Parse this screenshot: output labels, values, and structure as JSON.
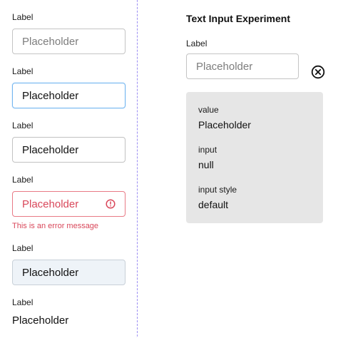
{
  "fields": [
    {
      "label": "Label",
      "value": "Placeholder"
    },
    {
      "label": "Label",
      "value": "Placeholder"
    },
    {
      "label": "Label",
      "value": "Placeholder"
    },
    {
      "label": "Label",
      "value": "Placeholder",
      "error_message": "This is an error message"
    },
    {
      "label": "Label",
      "value": "Placeholder"
    },
    {
      "label": "Label",
      "value": "Placeholder"
    }
  ],
  "experiment": {
    "title": "Text Input Experiment",
    "label": "Label",
    "placeholder": "Placeholder",
    "state": {
      "value_key": "value",
      "value_val": "Placeholder",
      "input_key": "input",
      "input_val": "null",
      "style_key": "input style",
      "style_val": "default"
    }
  },
  "icons": {
    "error": "error-circle-icon",
    "clear": "close-circle-icon"
  },
  "colors": {
    "focus_border": "#74b6f0",
    "error": "#d9475a",
    "panel_border": "#9a8cf2",
    "state_bg": "#e6e6e6"
  }
}
